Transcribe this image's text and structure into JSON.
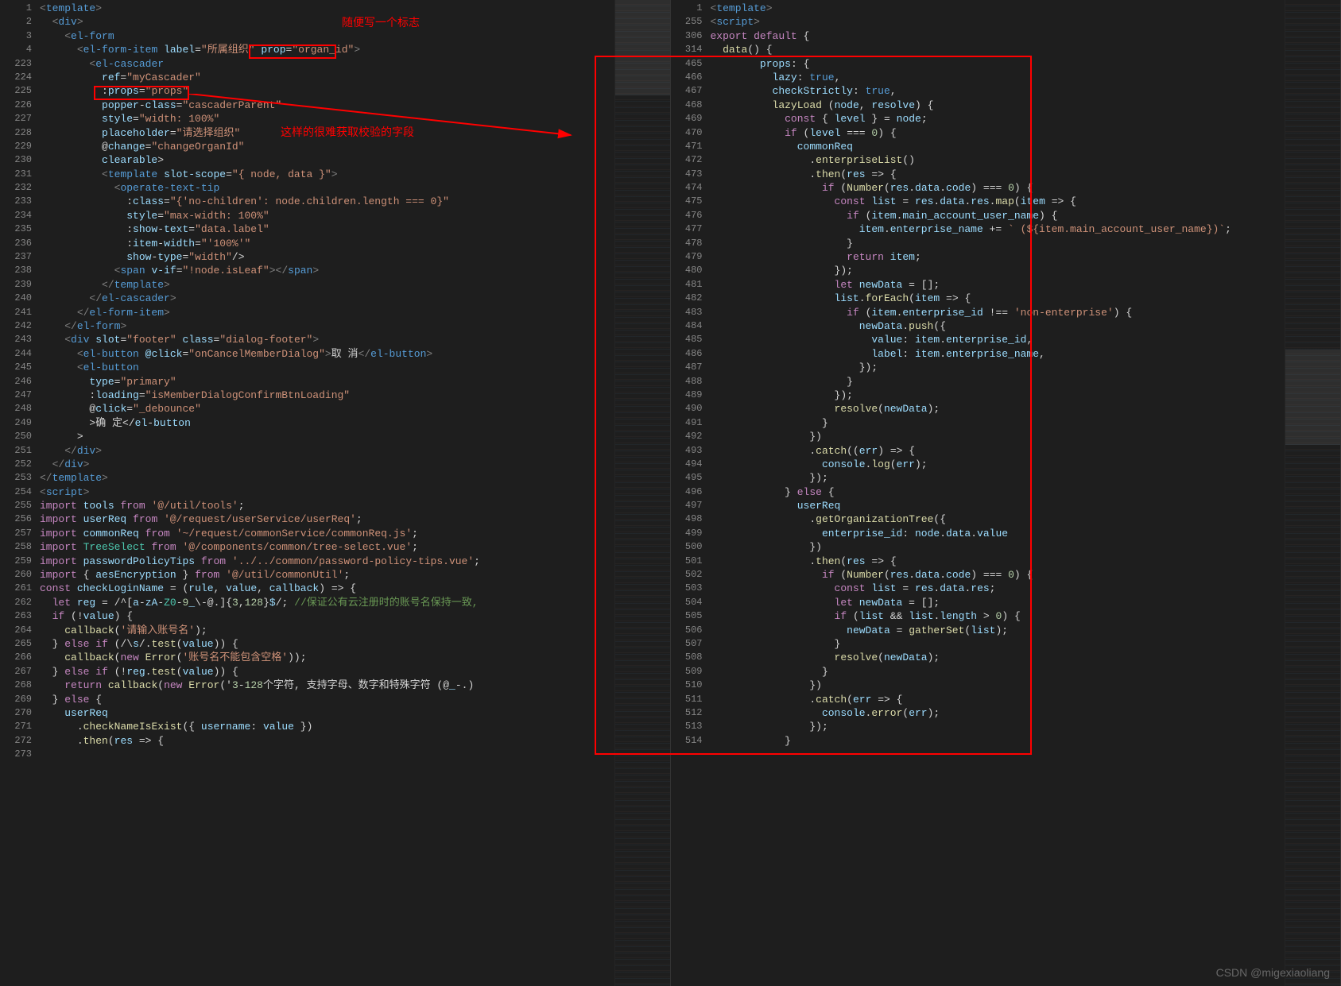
{
  "watermark": "CSDN @migexiaoliang",
  "annotations": {
    "label1": "随便写一个标志",
    "label2": "这样的很难获取校验的字段"
  },
  "left": {
    "lineNumbers": [
      1,
      2,
      3,
      4,
      223,
      224,
      225,
      226,
      227,
      228,
      229,
      230,
      231,
      232,
      233,
      234,
      235,
      236,
      237,
      238,
      239,
      240,
      241,
      242,
      243,
      244,
      245,
      246,
      247,
      248,
      249,
      250,
      251,
      252,
      253,
      254,
      255,
      256,
      257,
      258,
      259,
      260,
      261,
      262,
      263,
      264,
      265,
      266,
      267,
      268,
      269,
      270,
      271,
      272,
      273
    ],
    "code": [
      "<template>",
      "  <div>",
      "    <el-form",
      "      <el-form-item label=\"所属组织\" prop=\"organ_id\">",
      "        <el-cascader",
      "          ref=\"myCascader\"",
      "          :props=\"props\"",
      "          popper-class=\"cascaderParent\"",
      "          style=\"width: 100%\"",
      "          placeholder=\"请选择组织\"",
      "          @change=\"changeOrganId\"",
      "          clearable>",
      "          <template slot-scope=\"{ node, data }\">",
      "            <operate-text-tip",
      "              :class=\"{'no-children': node.children.length === 0}\"",
      "              style=\"max-width: 100%\"",
      "              :show-text=\"data.label\"",
      "              :item-width=\"'100%'\"",
      "              show-type=\"width\"/>",
      "            <span v-if=\"!node.isLeaf\"></span>",
      "          </template>",
      "        </el-cascader>",
      "      </el-form-item>",
      "    </el-form>",
      "    <div slot=\"footer\" class=\"dialog-footer\">",
      "      <el-button @click=\"onCancelMemberDialog\">取 消</el-button>",
      "      <el-button",
      "        type=\"primary\"",
      "        :loading=\"isMemberDialogConfirmBtnLoading\"",
      "        @click=\"_debounce\"",
      "        >确 定</el-button",
      "      >",
      "    </div>",
      "  </div>",
      "</template>",
      "<script>",
      "import tools from '@/util/tools';",
      "import userReq from '@/request/userService/userReq';",
      "import commonReq from '~/request/commonService/commonReq.js';",
      "import TreeSelect from '@/components/common/tree-select.vue';",
      "import passwordPolicyTips from '../../common/password-policy-tips.vue';",
      "import { aesEncryption } from '@/util/commonUtil';",
      "const checkLoginName = (rule, value, callback) => {",
      "  let reg = /^[a-zA-Z0-9_\\-@.]{3,128}$/; //保证公有云注册时的账号名保持一致,",
      "  if (!value) {",
      "    callback('请输入账号名');",
      "  } else if (/\\s/.test(value)) {",
      "    callback(new Error('账号名不能包含空格'));",
      "  } else if (!reg.test(value)) {",
      "    return callback(new Error('3-128个字符, 支持字母、数字和特殊字符 (@_-.)",
      "  } else {",
      "    userReq",
      "      .checkNameIsExist({ username: value })",
      "      .then(res => {"
    ],
    "minimapSlider": 0
  },
  "right": {
    "lineNumbers": [
      1,
      255,
      306,
      314,
      465,
      466,
      467,
      468,
      469,
      470,
      471,
      472,
      473,
      474,
      475,
      476,
      477,
      478,
      479,
      480,
      481,
      482,
      483,
      484,
      485,
      486,
      487,
      488,
      489,
      490,
      491,
      492,
      493,
      494,
      495,
      496,
      497,
      498,
      499,
      500,
      501,
      502,
      503,
      504,
      505,
      506,
      507,
      508,
      509,
      510,
      511,
      512,
      513,
      514
    ],
    "code": [
      "<template>",
      "<script>",
      "export default {",
      "  data() {",
      "        props: {",
      "          lazy: true,",
      "          checkStrictly: true,",
      "          lazyLoad (node, resolve) {",
      "            const { level } = node;",
      "            if (level === 0) {",
      "              commonReq",
      "                .enterpriseList()",
      "                .then(res => {",
      "                  if (Number(res.data.code) === 0) {",
      "                    const list = res.data.res.map(item => {",
      "                      if (item.main_account_user_name) {",
      "                        item.enterprise_name += ` (${item.main_account_user_name})`;",
      "                      }",
      "                      return item;",
      "                    });",
      "                    let newData = [];",
      "                    list.forEach(item => {",
      "                      if (item.enterprise_id !== 'non-enterprise') {",
      "                        newData.push({",
      "                          value: item.enterprise_id,",
      "                          label: item.enterprise_name,",
      "                        });",
      "                      }",
      "                    });",
      "                    resolve(newData);",
      "                  }",
      "                })",
      "                .catch((err) => {",
      "                  console.log(err);",
      "                });",
      "            } else {",
      "              userReq",
      "                .getOrganizationTree({",
      "                  enterprise_id: node.data.value",
      "                })",
      "                .then(res => {",
      "                  if (Number(res.data.code) === 0) {",
      "                    const list = res.data.res;",
      "                    let newData = [];",
      "                    if (list && list.length > 0) {",
      "                      newData = gatherSet(list);",
      "                    }",
      "                    resolve(newData);",
      "                  }",
      "                })",
      "                .catch(err => {",
      "                  console.error(err);",
      "                });",
      "            }"
    ],
    "minimapSlider": 440
  }
}
